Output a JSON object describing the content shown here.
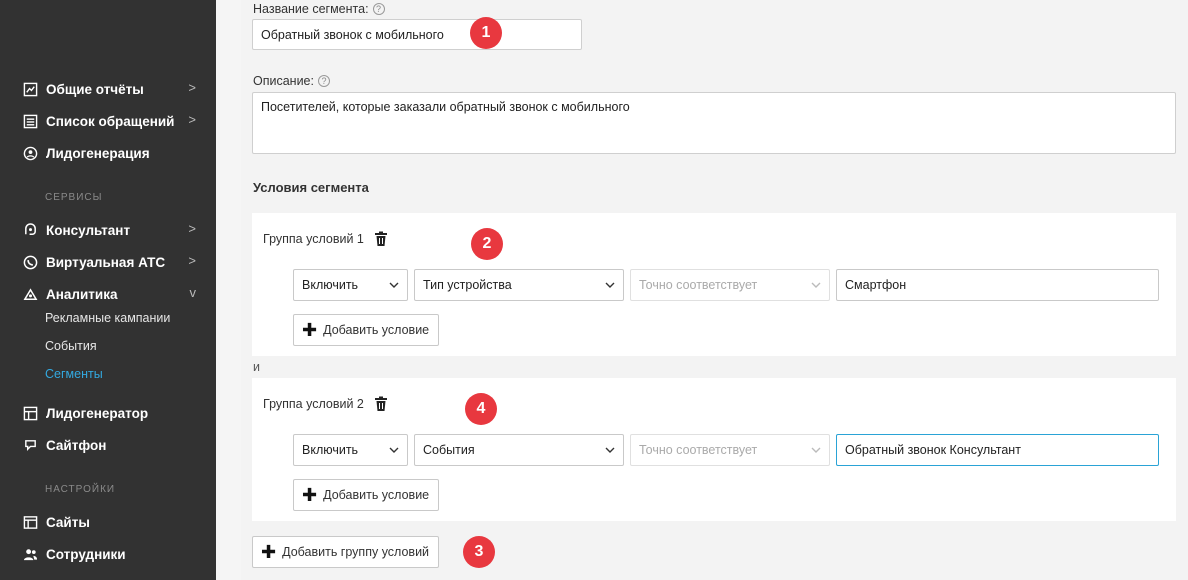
{
  "sidebar": {
    "items_top": [
      {
        "label": "Общие отчёты",
        "icon": "chart-icon",
        "chevron": ">"
      },
      {
        "label": "Список обращений",
        "icon": "list-icon",
        "chevron": ">"
      },
      {
        "label": "Лидогенерация",
        "icon": "people-icon",
        "chevron": ""
      }
    ],
    "section_services": "СЕРВИСЫ",
    "items_services": [
      {
        "label": "Консультант",
        "icon": "chat-icon",
        "chevron": ">"
      },
      {
        "label": "Виртуальная АТС",
        "icon": "phone-icon",
        "chevron": ">"
      },
      {
        "label": "Аналитика",
        "icon": "analytics-icon",
        "chevron": "v"
      }
    ],
    "analytics_sub": [
      "Рекламные кампании",
      "События",
      "Сегменты"
    ],
    "items_more": [
      {
        "label": "Лидогенератор",
        "icon": "lead-icon",
        "chevron": ""
      },
      {
        "label": "Сайтфон",
        "icon": "callback-icon",
        "chevron": ""
      }
    ],
    "section_settings": "НАСТРОЙКИ",
    "items_settings": [
      {
        "label": "Сайты",
        "icon": "sites-icon",
        "chevron": ""
      },
      {
        "label": "Сотрудники",
        "icon": "users-icon",
        "chevron": ""
      }
    ]
  },
  "form": {
    "name_label": "Название сегмента:",
    "name_value": "Обратный звонок с мобильного",
    "description_label": "Описание:",
    "description_value": "Посетителей, которые заказали обратный звонок с мобильного",
    "conditions_heading": "Условия сегмента",
    "help_glyph": "?"
  },
  "groups": [
    {
      "title": "Группа условий 1",
      "action": "Включить",
      "field": "Тип устройства",
      "operator": "Точно соответствует",
      "value": "Смартфон",
      "add_condition": "Добавить условие"
    },
    {
      "title": "Группа условий 2",
      "action": "Включить",
      "field": "События",
      "operator": "Точно соответствует",
      "value": "Обратный звонок Консультант",
      "add_condition": "Добавить условие"
    }
  ],
  "and_label": "и",
  "add_group": "Добавить группу условий",
  "badges": [
    "1",
    "2",
    "3",
    "4"
  ],
  "colors": {
    "sidebar_bg": "#323232",
    "active": "#33a9e0",
    "badge": "#e8383f",
    "focus": "#2aa3d6"
  }
}
